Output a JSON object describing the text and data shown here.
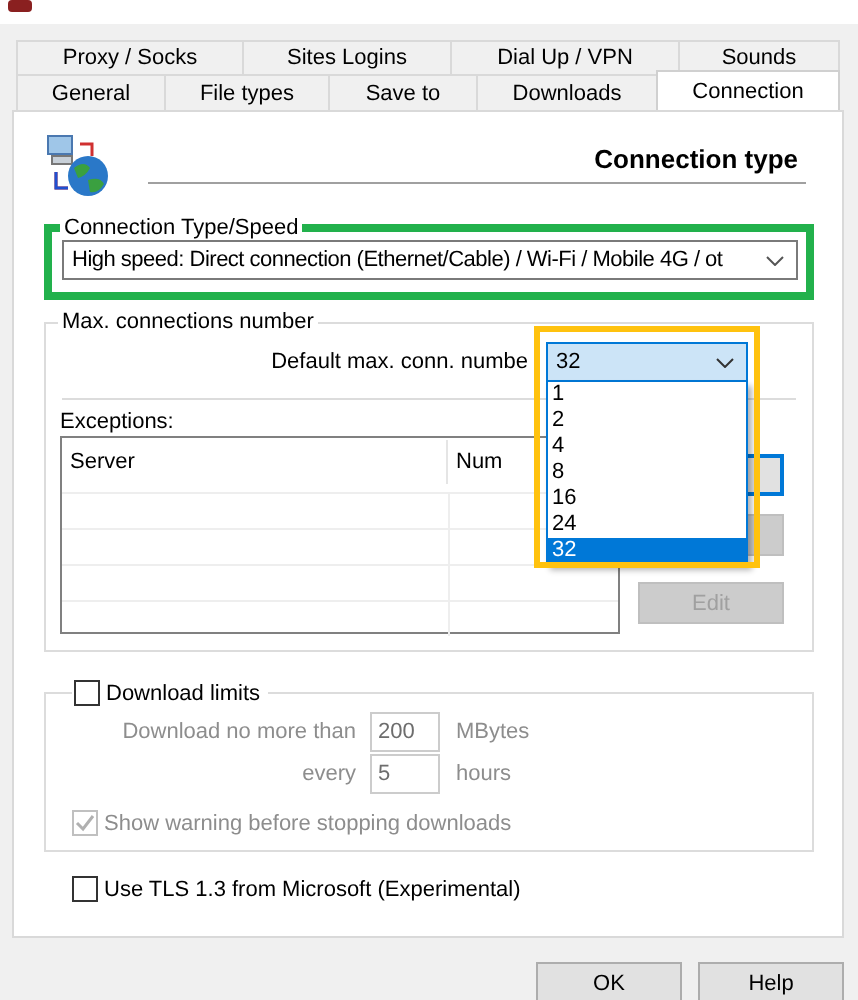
{
  "tabs_row_1": [
    {
      "label": "Proxy / Socks",
      "selected": false
    },
    {
      "label": "Sites Logins",
      "selected": false
    },
    {
      "label": "Dial Up / VPN",
      "selected": false
    },
    {
      "label": "Sounds",
      "selected": false
    }
  ],
  "tabs_row_2": [
    {
      "label": "General",
      "selected": false
    },
    {
      "label": "File types",
      "selected": false
    },
    {
      "label": "Save to",
      "selected": false
    },
    {
      "label": "Downloads",
      "selected": false
    },
    {
      "label": "Connection",
      "selected": true
    }
  ],
  "header": {
    "title": "Connection type"
  },
  "connection_group": {
    "label": "Connection Type/Speed",
    "value": "High speed: Direct connection (Ethernet/Cable) / Wi-Fi / Mobile 4G / ot"
  },
  "max_connections": {
    "label": "Max. connections number",
    "field_label": "Default max. conn. numbe",
    "value": "32",
    "expanded": true,
    "options": [
      {
        "label": "1",
        "selected": false
      },
      {
        "label": "2",
        "selected": false
      },
      {
        "label": "4",
        "selected": false
      },
      {
        "label": "8",
        "selected": false
      },
      {
        "label": "16",
        "selected": false
      },
      {
        "label": "24",
        "selected": false
      },
      {
        "label": "32",
        "selected": true
      }
    ]
  },
  "exceptions": {
    "label": "Exceptions:",
    "columns": [
      "Server",
      "Num"
    ],
    "buttons": [
      {
        "disabled": false,
        "focused": true
      },
      {
        "disabled": true,
        "focused": false
      },
      {
        "label": "Edit",
        "disabled": true,
        "focused": false
      }
    ]
  },
  "download_limits": {
    "label": "Download limits",
    "checked": false,
    "disabled": true,
    "limit_label": "Download no more than",
    "limit_value": "200",
    "limit_unit": "MBytes",
    "period_label": "every",
    "period_value": "5",
    "period_unit": "hours",
    "warning": {
      "label": "Show warning before stopping downloads",
      "checked": true,
      "disabled": true
    }
  },
  "tls": {
    "label": "Use TLS 1.3 from Microsoft (Experimental)",
    "checked": false
  },
  "buttons": [
    {
      "label": "OK"
    },
    {
      "label": "Help"
    }
  ]
}
